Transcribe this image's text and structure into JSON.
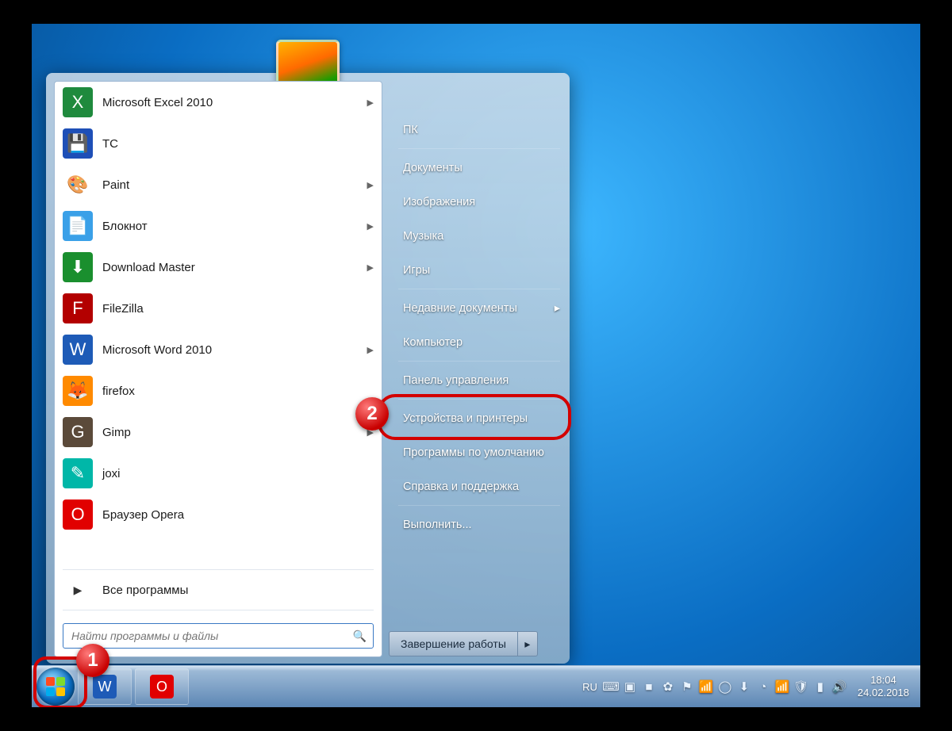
{
  "startmenu": {
    "programs": [
      {
        "label": "Microsoft Excel 2010",
        "has_sub": true,
        "icon": "X",
        "bg": "#1f8a3d"
      },
      {
        "label": "TC",
        "has_sub": false,
        "icon": "💾",
        "bg": "#1e4fb7"
      },
      {
        "label": "Paint",
        "has_sub": true,
        "icon": "🎨",
        "bg": "#fff"
      },
      {
        "label": "Блокнот",
        "has_sub": true,
        "icon": "📄",
        "bg": "#3aa0e8"
      },
      {
        "label": "Download Master",
        "has_sub": true,
        "icon": "⬇",
        "bg": "#1a8f2e"
      },
      {
        "label": "FileZilla",
        "has_sub": false,
        "icon": "F",
        "bg": "#b30000"
      },
      {
        "label": "Microsoft Word 2010",
        "has_sub": true,
        "icon": "W",
        "bg": "#1e5bb7"
      },
      {
        "label": "firefox",
        "has_sub": false,
        "icon": "🦊",
        "bg": "#ff8a00"
      },
      {
        "label": "Gimp",
        "has_sub": true,
        "icon": "G",
        "bg": "#5b4a3a"
      },
      {
        "label": "joxi",
        "has_sub": false,
        "icon": "✎",
        "bg": "#00b7a8"
      },
      {
        "label": "Браузер Opera",
        "has_sub": false,
        "icon": "O",
        "bg": "#e10000"
      }
    ],
    "all_programs": "Все программы",
    "search_placeholder": "Найти программы и файлы"
  },
  "rightlinks": [
    {
      "label": "ПК",
      "sub": false
    },
    {
      "label": "Документы",
      "sub": false
    },
    {
      "label": "Изображения",
      "sub": false
    },
    {
      "label": "Музыка",
      "sub": false
    },
    {
      "label": "Игры",
      "sub": false
    },
    {
      "label": "Недавние документы",
      "sub": true
    },
    {
      "label": "Компьютер",
      "sub": false
    },
    {
      "label": "Панель управления",
      "sub": false
    },
    {
      "label": "Устройства и принтеры",
      "sub": false
    },
    {
      "label": "Программы по умолчанию",
      "sub": false
    },
    {
      "label": "Справка и поддержка",
      "sub": false
    },
    {
      "label": "Выполнить...",
      "sub": false
    }
  ],
  "shutdown_label": "Завершение работы",
  "taskbar": {
    "apps": [
      {
        "label": "Word",
        "icon": "W",
        "bg": "#1e5bb7"
      },
      {
        "label": "Opera",
        "icon": "O",
        "bg": "#e10000"
      }
    ],
    "lang": "RU",
    "tray_icons": [
      "⌨",
      "▣",
      "■",
      "✿",
      "⚑",
      "📶",
      "◯",
      "⬇",
      "◔",
      "📶",
      "🛡",
      "▮",
      "🔊"
    ],
    "time": "18:04",
    "date": "24.02.2018"
  },
  "callouts": {
    "n1": "1",
    "n2": "2"
  }
}
